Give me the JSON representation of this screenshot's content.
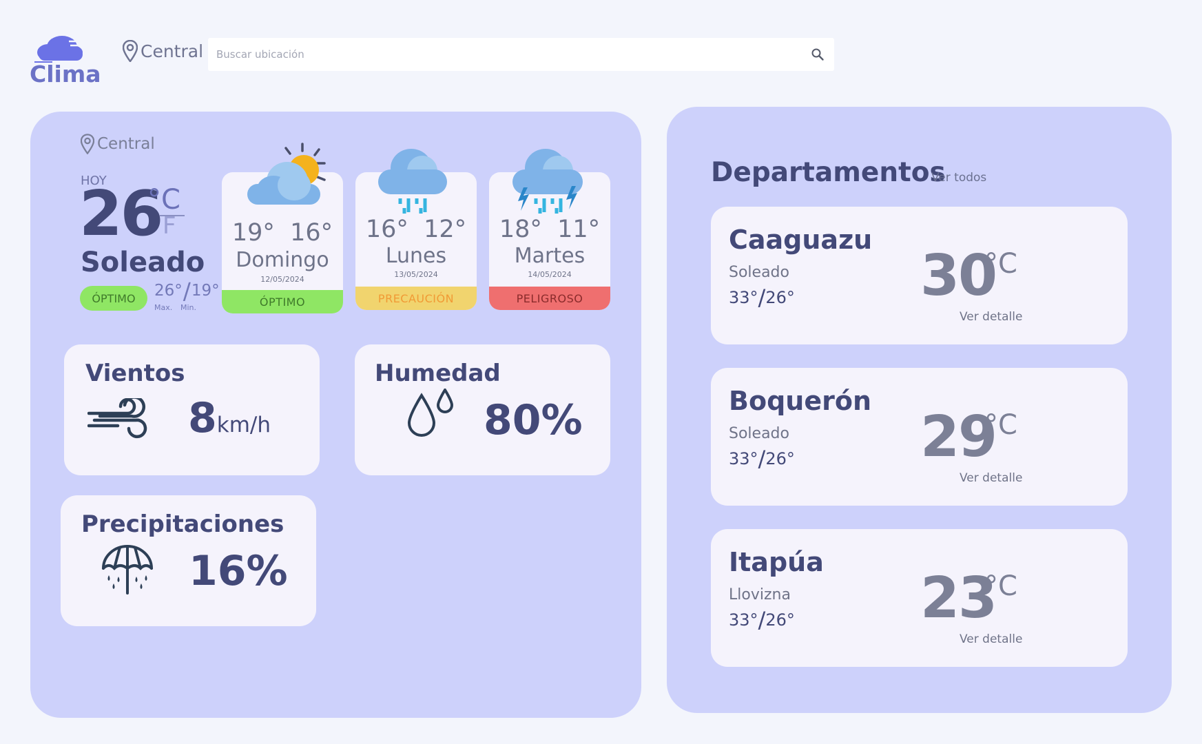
{
  "brand": {
    "name": "Clima"
  },
  "header": {
    "location": "Central",
    "search_placeholder": "Buscar ubicación"
  },
  "today": {
    "location": "Central",
    "label": "HOY",
    "temp": "26",
    "unit_c": "°C",
    "unit_f": "F",
    "condition": "Soleado",
    "status": "ÓPTIMO",
    "max": "26°",
    "min": "19°",
    "max_label": "Max.",
    "min_label": "Min."
  },
  "forecast": [
    {
      "day": "Domingo",
      "date": "12/05/2024",
      "max": "19°",
      "min": "16°",
      "status": "ÓPTIMO",
      "status_color": "#8fe664",
      "status_text_color": "#3f7a2a",
      "icon": "partly-cloudy-sun-icon"
    },
    {
      "day": "Lunes",
      "date": "13/05/2024",
      "max": "16°",
      "min": "12°",
      "status": "PRECAUCIÓN",
      "status_color": "#f1d46e",
      "status_text_color": "#f19a35",
      "icon": "rain-cloud-icon"
    },
    {
      "day": "Martes",
      "date": "14/05/2024",
      "max": "18°",
      "min": "11°",
      "status": "PELIGROSO",
      "status_color": "#ef6f6f",
      "status_text_color": "#8a2b2b",
      "icon": "storm-cloud-icon"
    }
  ],
  "stats": {
    "wind": {
      "title": "Vientos",
      "value": "8",
      "unit": "km/h",
      "icon": "wind-icon"
    },
    "humidity": {
      "title": "Humedad",
      "value": "80%",
      "icon": "droplets-icon"
    },
    "precip": {
      "title": "Precipitaciones",
      "value": "16%",
      "icon": "umbrella-rain-icon"
    }
  },
  "departments": {
    "title": "Departamentos",
    "see_all": "Ver todos",
    "items": [
      {
        "name": "Caaguazu",
        "condition": "Soleado",
        "max": "33°",
        "min": "26°",
        "temp": "30",
        "unit": "°C",
        "detail": "Ver detalle"
      },
      {
        "name": "Boquerón",
        "condition": "Soleado",
        "max": "33°",
        "min": "26°",
        "temp": "29",
        "unit": "°C",
        "detail": "Ver detalle"
      },
      {
        "name": "Itapúa",
        "condition": "Llovizna",
        "max": "33°",
        "min": "26°",
        "temp": "23",
        "unit": "°C",
        "detail": "Ver detalle"
      }
    ]
  },
  "colors": {
    "page_bg": "#f3f5fc",
    "panel_bg": "#cdd1fb",
    "card_bg": "#f5f3fc",
    "text_dark": "#434978",
    "brand_accent": "#6b72c6"
  }
}
